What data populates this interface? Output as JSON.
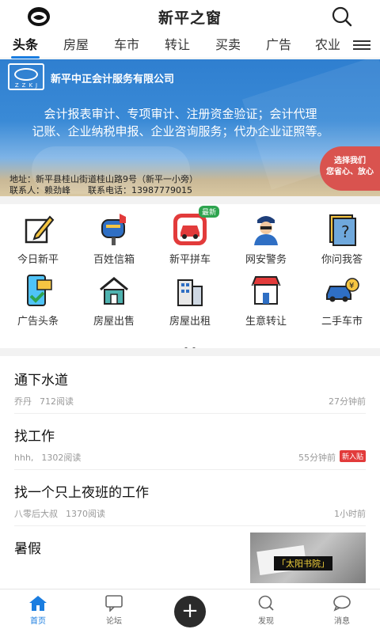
{
  "header": {
    "title": "新平之窗"
  },
  "tabs": [
    {
      "label": "头条"
    },
    {
      "label": "房屋"
    },
    {
      "label": "车市"
    },
    {
      "label": "转让"
    },
    {
      "label": "买卖"
    },
    {
      "label": "广告"
    },
    {
      "label": "农业"
    }
  ],
  "banner": {
    "logo_code": "ZZKJ",
    "company": "新平中正会计服务有限公司",
    "desc_line1": "会计报表审计、专项审计、注册资金验证；会计代理",
    "desc_line2": "记账、企业纳税申报、企业咨询服务；代办企业证照等。",
    "address": "地址：新平县桂山街道桂山路9号（新平一小旁）",
    "contact": "联系人：赖劲峰　　联系电话：13987779015",
    "badge_line1": "选择我们",
    "badge_line2": "您省心、放心"
  },
  "grid": {
    "row1": [
      {
        "label": "今日新平",
        "icon": "pencil-note-icon"
      },
      {
        "label": "百姓信箱",
        "icon": "mailbox-icon"
      },
      {
        "label": "新平拼车",
        "icon": "car-pool-icon",
        "badge": "最新"
      },
      {
        "label": "网安警务",
        "icon": "police-icon"
      },
      {
        "label": "你问我答",
        "icon": "question-icon"
      }
    ],
    "row2": [
      {
        "label": "广告头条",
        "icon": "phone-ad-icon"
      },
      {
        "label": "房屋出售",
        "icon": "house-icon"
      },
      {
        "label": "房屋出租",
        "icon": "building-icon"
      },
      {
        "label": "生意转让",
        "icon": "shop-icon"
      },
      {
        "label": "二手车市",
        "icon": "used-car-icon"
      }
    ]
  },
  "feed": [
    {
      "title": "通下水道",
      "author": "乔丹",
      "reads": "712阅读",
      "time": "27分钟前"
    },
    {
      "title": "找工作",
      "author": "hhh,",
      "reads": "1302阅读",
      "time": "55分钟前",
      "tag": "新入贴"
    },
    {
      "title": "找一个只上夜班的工作",
      "author": "八零后大叔",
      "reads": "1370阅读",
      "time": "1小时前"
    },
    {
      "title": "暑假",
      "thumb_text": "「太阳书院」"
    }
  ],
  "bottom_nav": [
    {
      "label": "首页"
    },
    {
      "label": "论坛"
    },
    {
      "label": "+"
    },
    {
      "label": "发现"
    },
    {
      "label": "消息"
    }
  ],
  "colors": {
    "accent": "#1a7de0",
    "new_tag": "#e23b3b",
    "badge_green": "#2ea44f"
  }
}
